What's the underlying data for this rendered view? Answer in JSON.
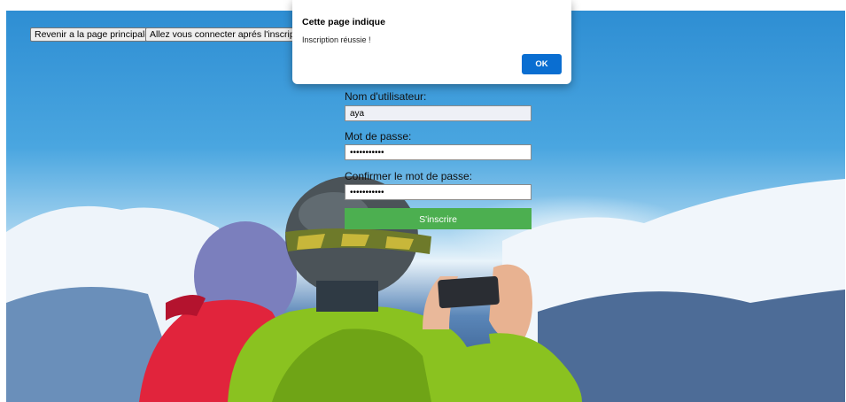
{
  "nav": {
    "back_label": "Revenir a la page principale",
    "login_label": "Allez vous connecter aprés l'inscription"
  },
  "form": {
    "username_label": "Nom d'utilisateur:",
    "username_value": "aya",
    "password_label": "Mot de passe:",
    "password_value": "•••••••••••",
    "confirm_label": "Confirmer le mot de passe:",
    "confirm_value": "•••••••••••",
    "submit_label": "S'inscrire"
  },
  "dialog": {
    "title": "Cette page indique",
    "message": "Inscription réussie !",
    "ok_label": "OK"
  },
  "colors": {
    "submit": "#4caf50",
    "ok_button": "#0a6ed1"
  }
}
